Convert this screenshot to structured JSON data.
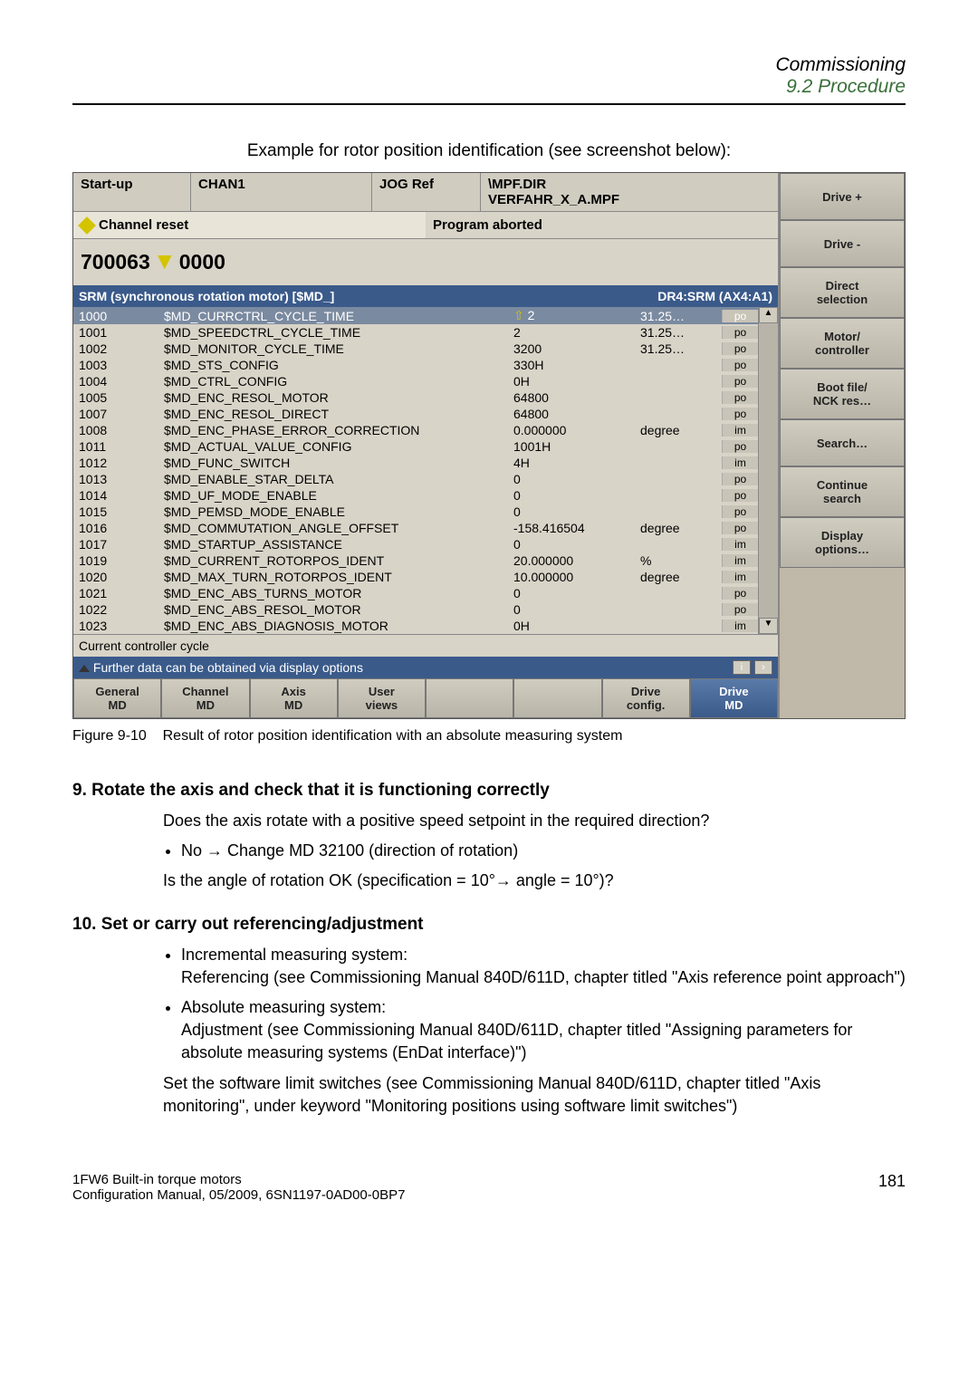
{
  "header": {
    "title": "Commissioning",
    "subtitle": "9.2 Procedure"
  },
  "example_caption": "Example for rotor position identification (see screenshot below):",
  "screenshot": {
    "row1": {
      "startup": "Start-up",
      "chan": "CHAN1",
      "jog": "JOG Ref",
      "path1": "\\MPF.DIR",
      "path2": "VERFAHR_X_A.MPF"
    },
    "row2": {
      "left": "Channel reset",
      "right": "Program aborted"
    },
    "alarm_num": "700063",
    "alarm_zero": "0000",
    "table_header_left": "SRM (synchronous rotation motor) [$MD_]",
    "table_header_right": "DR4:SRM (AX4:A1)",
    "rows": [
      {
        "n": "1000",
        "name": "$MD_CURRCTRL_CYCLE_TIME",
        "v": "2",
        "u": "31.25…",
        "f": "po",
        "sel": true,
        "icon": "up"
      },
      {
        "n": "1001",
        "name": "$MD_SPEEDCTRL_CYCLE_TIME",
        "v": "2",
        "u": "31.25…",
        "f": "po"
      },
      {
        "n": "1002",
        "name": "$MD_MONITOR_CYCLE_TIME",
        "v": "3200",
        "u": "31.25…",
        "f": "po"
      },
      {
        "n": "1003",
        "name": "$MD_STS_CONFIG",
        "v": "330H",
        "u": "",
        "f": "po"
      },
      {
        "n": "1004",
        "name": "$MD_CTRL_CONFIG",
        "v": "0H",
        "u": "",
        "f": "po"
      },
      {
        "n": "1005",
        "name": "$MD_ENC_RESOL_MOTOR",
        "v": "64800",
        "u": "",
        "f": "po"
      },
      {
        "n": "1007",
        "name": "$MD_ENC_RESOL_DIRECT",
        "v": "64800",
        "u": "",
        "f": "po"
      },
      {
        "n": "1008",
        "name": "$MD_ENC_PHASE_ERROR_CORRECTION",
        "v": "0.000000",
        "u": "degree",
        "f": "im"
      },
      {
        "n": "1011",
        "name": "$MD_ACTUAL_VALUE_CONFIG",
        "v": "1001H",
        "u": "",
        "f": "po"
      },
      {
        "n": "1012",
        "name": "$MD_FUNC_SWITCH",
        "v": "4H",
        "u": "",
        "f": "im"
      },
      {
        "n": "1013",
        "name": "$MD_ENABLE_STAR_DELTA",
        "v": "0",
        "u": "",
        "f": "po"
      },
      {
        "n": "1014",
        "name": "$MD_UF_MODE_ENABLE",
        "v": "0",
        "u": "",
        "f": "po"
      },
      {
        "n": "1015",
        "name": "$MD_PEMSD_MODE_ENABLE",
        "v": "0",
        "u": "",
        "f": "po"
      },
      {
        "n": "1016",
        "name": "$MD_COMMUTATION_ANGLE_OFFSET",
        "v": "-158.416504",
        "u": "degree",
        "f": "po"
      },
      {
        "n": "1017",
        "name": "$MD_STARTUP_ASSISTANCE",
        "v": "0",
        "u": "",
        "f": "im"
      },
      {
        "n": "1019",
        "name": "$MD_CURRENT_ROTORPOS_IDENT",
        "v": "20.000000",
        "u": "%",
        "f": "im"
      },
      {
        "n": "1020",
        "name": "$MD_MAX_TURN_ROTORPOS_IDENT",
        "v": "10.000000",
        "u": "degree",
        "f": "im"
      },
      {
        "n": "1021",
        "name": "$MD_ENC_ABS_TURNS_MOTOR",
        "v": "0",
        "u": "",
        "f": "po"
      },
      {
        "n": "1022",
        "name": "$MD_ENC_ABS_RESOL_MOTOR",
        "v": "0",
        "u": "",
        "f": "po"
      },
      {
        "n": "1023",
        "name": "$MD_ENC_ABS_DIAGNOSIS_MOTOR",
        "v": "0H",
        "u": "",
        "f": "im"
      }
    ],
    "status_line": "Current controller cycle",
    "info_line": "Further data can be obtained via display options",
    "softkeys": [
      "General\nMD",
      "Channel\nMD",
      "Axis\nMD",
      "User\nviews",
      "",
      "",
      "Drive\nconfig.",
      "Drive\nMD"
    ],
    "side": [
      "Drive +",
      "Drive -",
      "Direct\nselection",
      "Motor/\ncontroller",
      "Boot file/\nNCK res…",
      "Search…",
      "Continue\nsearch",
      "Display\noptions…"
    ]
  },
  "figure_caption_label": "Figure 9-10",
  "figure_caption_text": "Result of rotor position identification with an absolute measuring system",
  "section9": {
    "heading": "9. Rotate the axis and check that it is functioning correctly",
    "line1": "Does the axis rotate with a positive speed setpoint in the required direction?",
    "bullet1": "No → Change MD 32100 (direction of rotation)",
    "line2": "Is the angle of rotation OK (specification = 10°→ angle = 10°)?"
  },
  "section10": {
    "heading": "10. Set or carry out referencing/adjustment",
    "bullet1a": "Incremental measuring system:",
    "bullet1b": "Referencing (see Commissioning Manual 840D/611D, chapter titled \"Axis reference point approach\")",
    "bullet2a": "Absolute measuring system:",
    "bullet2b": "Adjustment (see Commissioning Manual 840D/611D, chapter titled \"Assigning parameters for absolute measuring systems (EnDat interface)\")",
    "para": "Set the software limit switches (see Commissioning Manual 840D/611D, chapter titled \"Axis monitoring\", under keyword \"Monitoring positions using software limit switches\")"
  },
  "footer": {
    "line1": "1FW6 Built-in torque motors",
    "line2": "Configuration Manual, 05/2009, 6SN1197-0AD00-0BP7",
    "page": "181"
  }
}
